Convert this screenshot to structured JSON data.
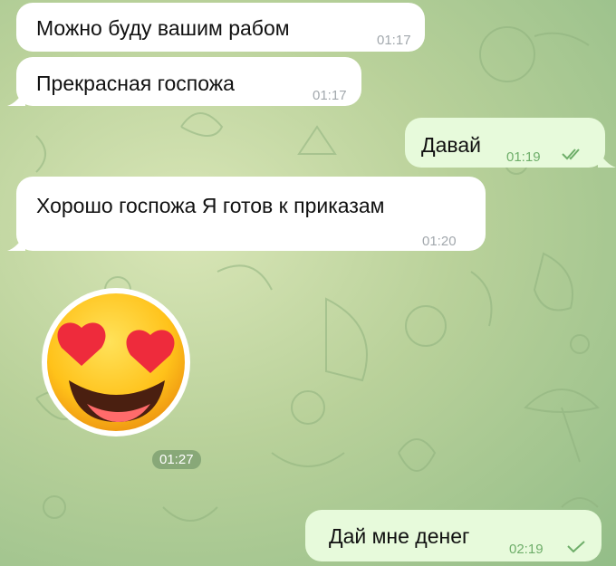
{
  "messages": [
    {
      "text": "Можно буду вашим рабом",
      "time": "01:17",
      "direction": "incoming"
    },
    {
      "text": "Прекрасная госпожа",
      "time": "01:17",
      "direction": "incoming"
    },
    {
      "text": "Давай",
      "time": "01:19",
      "direction": "outgoing",
      "status": "read-double-check-icon"
    },
    {
      "text": "Хорошо госпожа Я готов к приказам",
      "time": "01:20",
      "direction": "incoming"
    },
    {
      "sticker": "heart-eyes-emoji-icon",
      "time": "01:27",
      "direction": "incoming"
    },
    {
      "text": "Дай мне денег",
      "time": "02:19",
      "direction": "outgoing",
      "status": "sent-single-check-icon"
    }
  ],
  "colors": {
    "incoming_bubble": "#ffffff",
    "outgoing_bubble": "#e7fadb",
    "outgoing_meta": "#6fae6a",
    "incoming_meta": "#a2a8ad",
    "wallpaper": "#b9d19a"
  }
}
